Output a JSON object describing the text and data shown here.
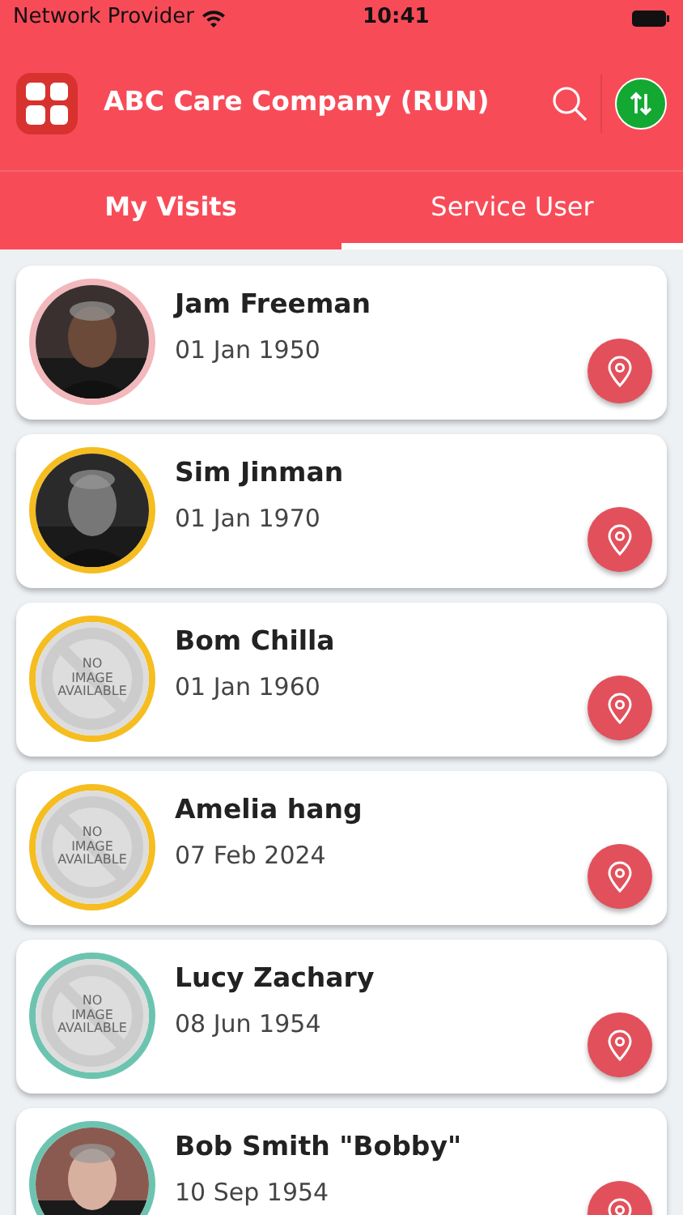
{
  "status_bar": {
    "carrier": "Network Provider",
    "time": "10:41"
  },
  "header": {
    "title": "ABC Care Company (RUN)"
  },
  "tabs": [
    {
      "label": "My Visits",
      "selected": false
    },
    {
      "label": "Service User",
      "selected": true
    }
  ],
  "service_users": [
    {
      "name": "Jam Freeman",
      "date": "01 Jan 1950",
      "color": "#f2b8bc"
    },
    {
      "name": "Sim Jinman",
      "date": "01 Jan 1970",
      "color": "#f5bd1f"
    },
    {
      "name": "Bom Chilla",
      "date": "01 Jan 1960",
      "color": "#f5bd1f",
      "avatar": {
        "kind": "placeholder",
        "text": [
          "NO",
          "IMAGE",
          "AVAILABLE"
        ]
      }
    },
    {
      "name": "Amelia hang",
      "date": "07 Feb 2024",
      "color": "#f5bd1f",
      "avatar": {
        "kind": "placeholder",
        "text": [
          "NO",
          "IMAGE",
          "AVAILABLE"
        ]
      }
    },
    {
      "name": "Lucy Zachary",
      "date": "08 Jun 1954",
      "color": "#6cc4b0",
      "avatar": {
        "kind": "placeholder",
        "text": [
          "NO",
          "IMAGE",
          "AVAILABLE"
        ]
      }
    },
    {
      "name": "Bob Smith \"Bobby\"",
      "date": "10 Sep 1954",
      "color": "#6cc4b0"
    }
  ]
}
